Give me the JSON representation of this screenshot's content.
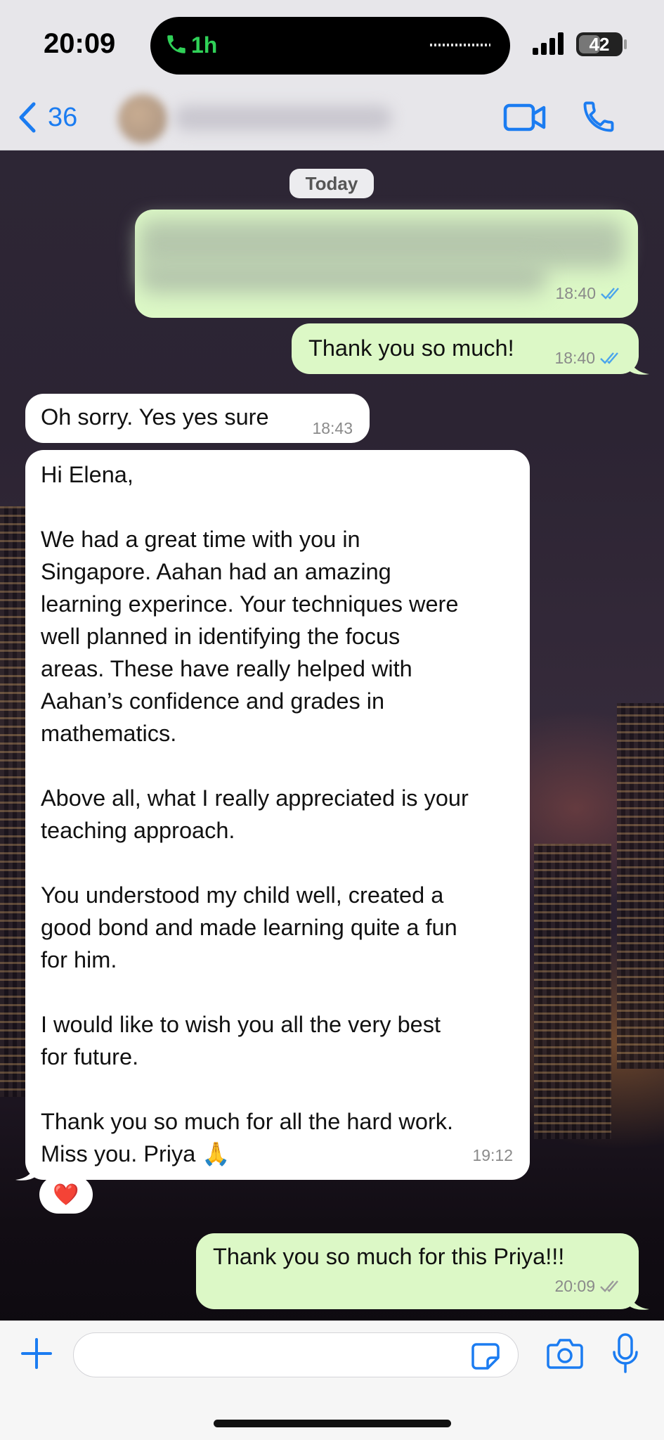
{
  "status_bar": {
    "time": "20:09",
    "call_duration": "1h",
    "battery": "42",
    "call_color": "#30d158"
  },
  "header": {
    "back_count": "36",
    "accent_color": "#1b7cf1",
    "icons": [
      "chevron-left-icon",
      "video-camera-icon",
      "phone-icon"
    ]
  },
  "chat": {
    "date_label": "Today",
    "messages": [
      {
        "direction": "outgoing",
        "text": "",
        "time": "18:40",
        "status": "read"
      },
      {
        "direction": "outgoing",
        "text": "Thank you so much!",
        "time": "18:40",
        "status": "read"
      },
      {
        "direction": "incoming",
        "text": "Oh sorry. Yes yes sure",
        "time": "18:43"
      },
      {
        "direction": "incoming",
        "lines": [
          "Hi Elena,",
          "",
          "We had a great time with you in",
          "Singapore. Aahan had an amazing",
          "learning experince. Your techniques were",
          "well planned in identifying the focus",
          "areas. These have really helped with",
          "Aahan’s confidence and grades in",
          "mathematics.",
          "",
          "Above all, what I really appreciated is your",
          "teaching approach.",
          "",
          "You understood my child well, created a",
          "good bond and made learning quite a fun",
          "for him.",
          "",
          "I would like to wish you all the very best",
          "for future.",
          "",
          "Thank you so much for all the hard work.",
          "Miss you. Priya 🙏"
        ],
        "time": "19:12",
        "reaction": "❤️"
      },
      {
        "direction": "outgoing",
        "text": "Thank you so much for this Priya!!!",
        "time": "20:09",
        "status": "delivered"
      }
    ]
  },
  "composer": {
    "placeholder": "",
    "icons": [
      "plus-icon",
      "sticker-icon",
      "camera-icon",
      "microphone-icon"
    ]
  }
}
